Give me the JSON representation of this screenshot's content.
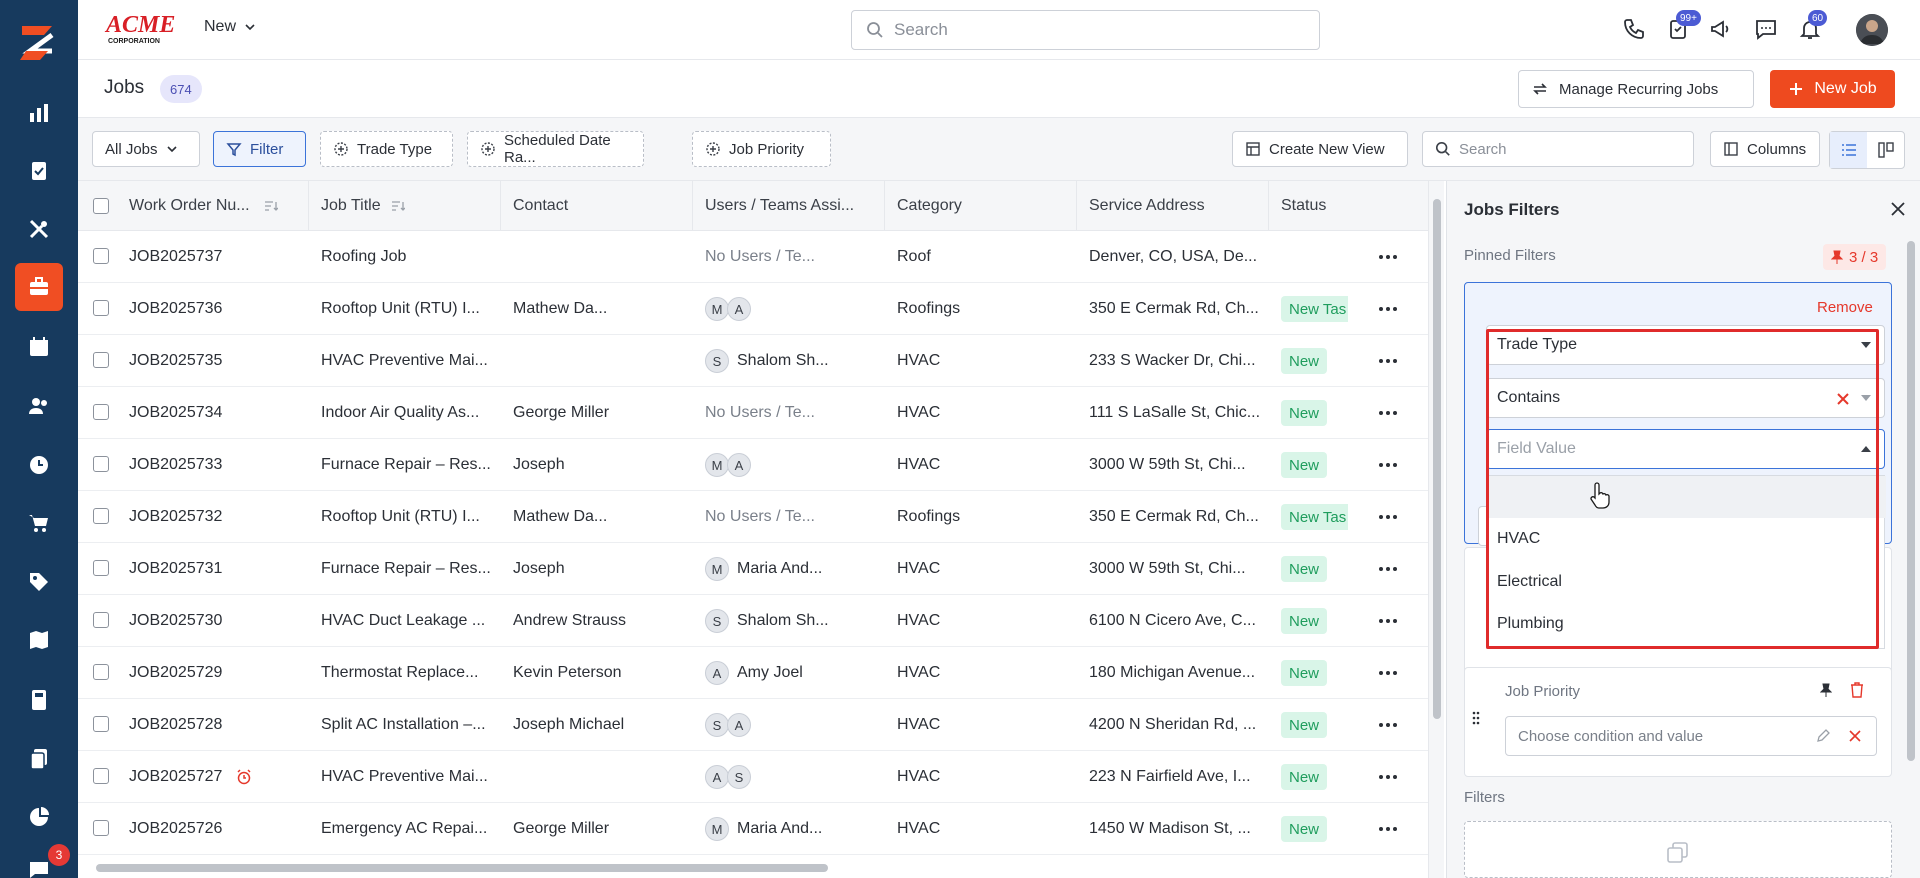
{
  "app": {
    "brand_name": "ACME CORPORATION",
    "new_menu_label": "New",
    "search_placeholder": "Search",
    "badges": {
      "tasks": "99+",
      "notifications": "60",
      "chat": "3"
    }
  },
  "sidebar": {
    "items": [
      {
        "icon": "analytics-icon"
      },
      {
        "icon": "clipboard-check-icon"
      },
      {
        "icon": "tools-icon"
      },
      {
        "icon": "briefcase-icon",
        "active": true
      },
      {
        "icon": "calendar-icon"
      },
      {
        "icon": "users-icon"
      },
      {
        "icon": "clock-icon"
      },
      {
        "icon": "cart-icon"
      },
      {
        "icon": "tag-icon"
      },
      {
        "icon": "map-icon"
      },
      {
        "icon": "calculator-icon"
      },
      {
        "icon": "documents-icon"
      },
      {
        "icon": "pie-chart-icon"
      },
      {
        "icon": "chat-icon"
      }
    ]
  },
  "page": {
    "title": "Jobs",
    "count": "674",
    "manage_recurring_label": "Manage Recurring Jobs",
    "new_job_label": "New Job"
  },
  "toolbar": {
    "all_jobs_label": "All Jobs",
    "filter_label": "Filter",
    "chips": [
      "Trade Type",
      "Scheduled Date Ra...",
      "Job Priority"
    ],
    "create_view_label": "Create New View",
    "search_placeholder": "Search",
    "columns_label": "Columns"
  },
  "table": {
    "columns": [
      "Work Order Nu...",
      "Job Title",
      "Contact",
      "Users / Teams Assi...",
      "Category",
      "Service Address",
      "Status"
    ],
    "rows": [
      {
        "wo": "JOB2025737",
        "title": "Roofing Job",
        "contact": "",
        "users_text": "No Users / Te...",
        "avatars": [],
        "category": "Roof",
        "address": "Denver, CO, USA, De...",
        "status": ""
      },
      {
        "wo": "JOB2025736",
        "title": "Rooftop Unit (RTU) I...",
        "contact": "Mathew Da...",
        "users_text": "",
        "avatars": [
          "M",
          "A"
        ],
        "category": "Roofings",
        "address": "350 E Cermak Rd, Ch...",
        "status": "New Tas"
      },
      {
        "wo": "JOB2025735",
        "title": "HVAC Preventive Mai...",
        "contact": "",
        "users_text": "Shalom Sh...",
        "avatars": [
          "S"
        ],
        "category": "HVAC",
        "address": "233 S Wacker Dr, Chi...",
        "status": "New"
      },
      {
        "wo": "JOB2025734",
        "title": "Indoor Air Quality As...",
        "contact": "George Miller",
        "users_text": "No Users / Te...",
        "avatars": [],
        "category": "HVAC",
        "address": "111 S LaSalle St, Chic...",
        "status": "New"
      },
      {
        "wo": "JOB2025733",
        "title": "Furnace Repair – Res...",
        "contact": "Joseph",
        "users_text": "",
        "avatars": [
          "M",
          "A"
        ],
        "category": "HVAC",
        "address": "3000 W 59th St, Chi...",
        "status": "New"
      },
      {
        "wo": "JOB2025732",
        "title": "Rooftop Unit (RTU) I...",
        "contact": "Mathew Da...",
        "users_text": "No Users / Te...",
        "avatars": [],
        "category": "Roofings",
        "address": "350 E Cermak Rd, Ch...",
        "status": "New Tas"
      },
      {
        "wo": "JOB2025731",
        "title": "Furnace Repair – Res...",
        "contact": "Joseph",
        "users_text": "Maria And...",
        "avatars": [
          "M"
        ],
        "category": "HVAC",
        "address": "3000 W 59th St, Chi...",
        "status": "New"
      },
      {
        "wo": "JOB2025730",
        "title": "HVAC Duct Leakage ...",
        "contact": "Andrew Strauss",
        "users_text": "Shalom Sh...",
        "avatars": [
          "S"
        ],
        "category": "HVAC",
        "address": "6100 N Cicero Ave, C...",
        "status": "New"
      },
      {
        "wo": "JOB2025729",
        "title": "Thermostat Replace...",
        "contact": "Kevin Peterson",
        "users_text": "Amy Joel",
        "avatars": [
          "A"
        ],
        "category": "HVAC",
        "address": "180 Michigan Avenue...",
        "status": "New"
      },
      {
        "wo": "JOB2025728",
        "title": "Split AC Installation –...",
        "contact": "Joseph Michael",
        "users_text": "",
        "avatars": [
          "S",
          "A"
        ],
        "category": "HVAC",
        "address": "4200 N Sheridan Rd, ...",
        "status": "New"
      },
      {
        "wo": "JOB2025727",
        "title": "HVAC Preventive Mai...",
        "contact": "",
        "users_text": "",
        "avatars": [
          "A",
          "S"
        ],
        "category": "HVAC",
        "address": "223 N Fairfield Ave, I...",
        "status": "New",
        "alarm": true
      },
      {
        "wo": "JOB2025726",
        "title": "Emergency AC Repai...",
        "contact": "George Miller",
        "users_text": "Maria And...",
        "avatars": [
          "M"
        ],
        "category": "HVAC",
        "address": "1450 W Madison St, ...",
        "status": "New"
      }
    ]
  },
  "filters_panel": {
    "title": "Jobs Filters",
    "pinned_label": "Pinned Filters",
    "pinned_count": "3 / 3",
    "remove_label": "Remove",
    "field_select": "Trade Type",
    "condition_select": "Contains",
    "value_placeholder": "Field Value",
    "options": [
      "",
      "HVAC",
      "Electrical",
      "Plumbing"
    ],
    "job_priority_label": "Job Priority",
    "job_priority_placeholder": "Choose condition and value",
    "filters_label": "Filters"
  },
  "colors": {
    "sidebar": "#173a5e",
    "accent": "#ee4a1f",
    "status_new_bg": "#d9f5e8",
    "status_new_text": "#1f9d5d",
    "highlight": "#e02b2b"
  }
}
